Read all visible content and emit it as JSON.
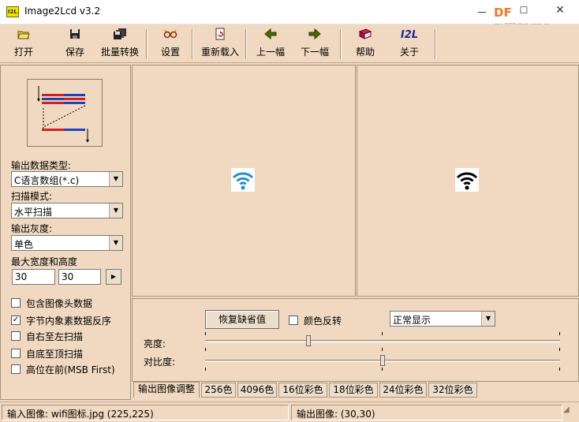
{
  "window": {
    "icon_text": "I2L",
    "title": "Image2Lcd v3.2",
    "minimize": "－",
    "maximize": "☐",
    "close": "✕",
    "watermark": "DF",
    "watermark_sub": "mc.DFRobot.com.cn"
  },
  "toolbar": {
    "open": "打开",
    "save": "保存",
    "batch": "批量转换",
    "settings": "设置",
    "reload": "重新载入",
    "prev": "上一幅",
    "next": "下一幅",
    "help": "帮助",
    "about": "关于"
  },
  "left": {
    "output_type_label": "输出数据类型:",
    "output_type_value": "C语言数组(*.c)",
    "scan_mode_label": "扫描模式:",
    "scan_mode_value": "水平扫描",
    "gray_label": "输出灰度:",
    "gray_value": "单色",
    "size_label": "最大宽度和高度",
    "max_width": "30",
    "max_height": "30",
    "options": [
      {
        "label": "包含图像头数据",
        "checked": false
      },
      {
        "label": "字节内象素数据反序",
        "checked": true
      },
      {
        "label": "自右至左扫描",
        "checked": false
      },
      {
        "label": "自底至顶扫描",
        "checked": false
      },
      {
        "label": "高位在前(MSB First)",
        "checked": false
      }
    ]
  },
  "adjust": {
    "restore_label": "恢复缺省值",
    "invert_label": "颜色反转",
    "display_mode": "正常显示",
    "brightness_label": "亮度:",
    "contrast_label": "对比度:",
    "brightness_level": 0.29,
    "contrast_level": 0.5
  },
  "tabs": [
    "输出图像调整",
    "256色",
    "4096色",
    "16位彩色",
    "18位彩色",
    "24位彩色",
    "32位彩色"
  ],
  "status": {
    "input": "输入图像: wifi图标.jpg (225,225)",
    "output": "输出图像: (30,30)"
  },
  "colors": {
    "panel_bg": "#f0d9c0",
    "wifi_input": "#1e8fd6",
    "wifi_output": "#000000"
  }
}
